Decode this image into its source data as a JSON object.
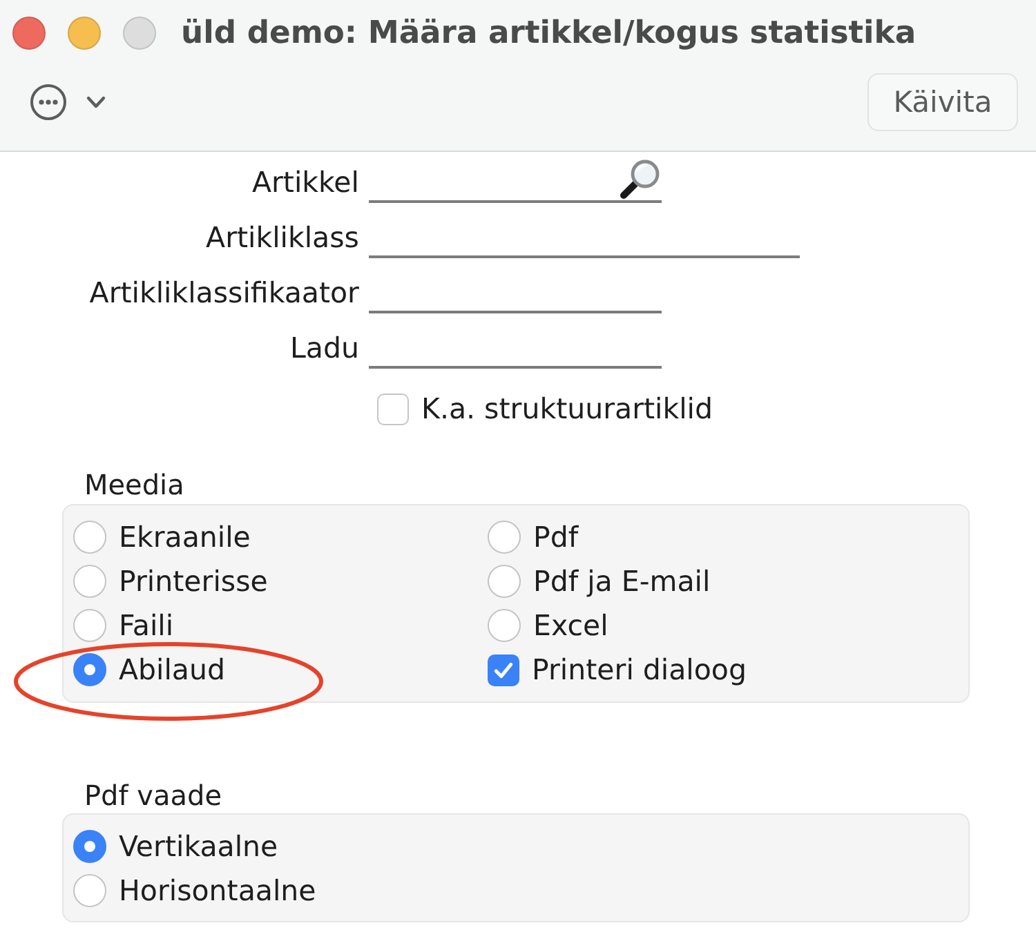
{
  "window": {
    "title": "üld demo: Määra artikkel/kogus statistika",
    "buttons": [
      {
        "kind": "close",
        "disabled": false
      },
      {
        "kind": "minimize",
        "disabled": false
      },
      {
        "kind": "zoom",
        "disabled": true
      }
    ]
  },
  "toolbar": {
    "run_button": "Käivita"
  },
  "form": {
    "fields": [
      {
        "label": "Artikkel",
        "kind": "lookup"
      },
      {
        "label": "Artikliklass",
        "kind": "text"
      },
      {
        "label": "Artikliklassifikaator",
        "kind": "text"
      },
      {
        "label": "Ladu",
        "kind": "text"
      }
    ],
    "checkbox": {
      "label": "K.a. struktuurartiklid",
      "checked": false
    }
  },
  "media": {
    "title": "Meedia",
    "options": [
      {
        "label": "Ekraanile",
        "kind": "radio",
        "selected": false,
        "circled": false
      },
      {
        "label": "Printerisse",
        "kind": "radio",
        "selected": false,
        "circled": false
      },
      {
        "label": "Faili",
        "kind": "radio",
        "selected": false,
        "circled": false
      },
      {
        "label": "Abilaud",
        "kind": "radio",
        "selected": true,
        "circled": true
      },
      {
        "label": "Pdf",
        "kind": "radio",
        "selected": false,
        "circled": false
      },
      {
        "label": "Pdf ja E-mail",
        "kind": "radio",
        "selected": false,
        "circled": false
      },
      {
        "label": "Excel",
        "kind": "radio",
        "selected": false,
        "circled": false
      },
      {
        "label": "Printeri dialoog",
        "kind": "checkbox",
        "checked": true,
        "circled": false
      }
    ]
  },
  "pdf_view": {
    "title": "Pdf vaade",
    "options": [
      {
        "label": "Vertikaalne",
        "selected": true
      },
      {
        "label": "Horisontaalne",
        "selected": false
      }
    ]
  }
}
